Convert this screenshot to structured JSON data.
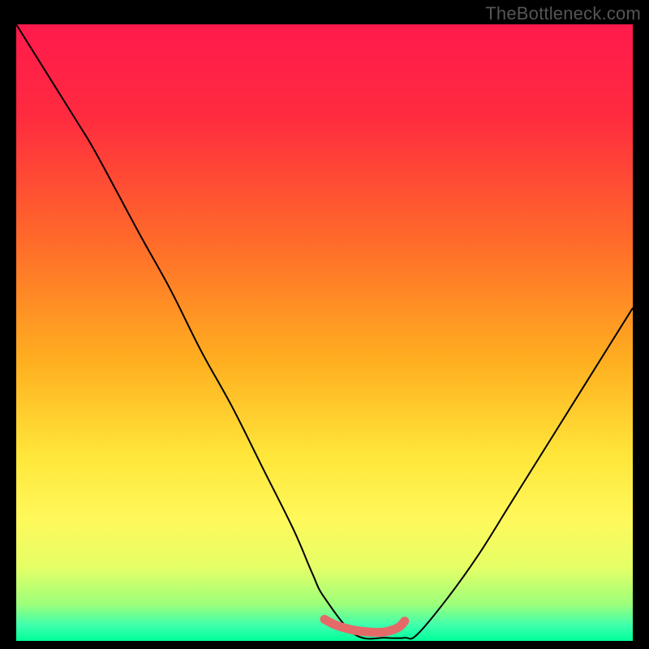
{
  "watermark": "TheBottleneck.com",
  "chart_data": {
    "type": "line",
    "title": "",
    "xlabel": "",
    "ylabel": "",
    "xlim": [
      0,
      100
    ],
    "ylim": [
      0,
      100
    ],
    "series": [
      {
        "name": "bottleneck-curve",
        "x": [
          0,
          5,
          10,
          13,
          20,
          25,
          30,
          35,
          40,
          45,
          48,
          50,
          55,
          60,
          63,
          65,
          70,
          75,
          80,
          85,
          90,
          95,
          100
        ],
        "y": [
          100,
          92,
          84,
          79,
          66,
          57,
          47,
          38,
          28,
          18,
          11,
          7,
          1,
          0.5,
          0.5,
          1,
          7,
          14,
          22,
          30,
          38,
          46,
          54
        ]
      },
      {
        "name": "sweet-spot-overlay",
        "x": [
          50,
          52,
          55,
          58,
          60,
          62,
          63
        ],
        "y": [
          3.5,
          2.5,
          1.7,
          1.4,
          1.5,
          2.2,
          3.2
        ]
      }
    ],
    "gradient_stops": [
      {
        "pos": 0.0,
        "color": "#ff1a4d"
      },
      {
        "pos": 0.15,
        "color": "#ff2b3f"
      },
      {
        "pos": 0.35,
        "color": "#ff6a2a"
      },
      {
        "pos": 0.55,
        "color": "#ffb020"
      },
      {
        "pos": 0.7,
        "color": "#ffe63a"
      },
      {
        "pos": 0.8,
        "color": "#fff85a"
      },
      {
        "pos": 0.88,
        "color": "#e6ff66"
      },
      {
        "pos": 0.94,
        "color": "#9dff7a"
      },
      {
        "pos": 0.975,
        "color": "#3dffad"
      },
      {
        "pos": 1.0,
        "color": "#00ff99"
      }
    ],
    "overlay_color": "#e46a6a"
  }
}
